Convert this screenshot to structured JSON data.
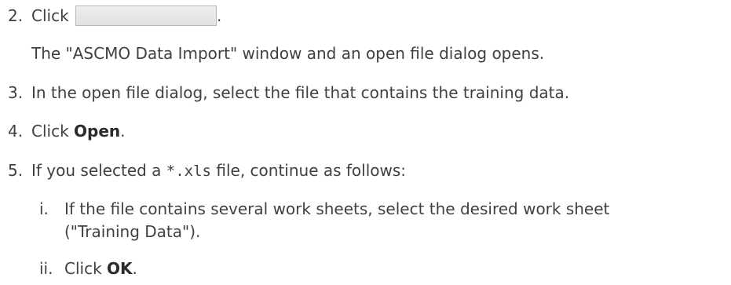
{
  "steps": [
    {
      "num": "2.",
      "before": "Click",
      "after": "."
    },
    {
      "result": "The \"ASCMO Data Import\" window and an open file dialog opens."
    },
    {
      "num": "3.",
      "text": "In the open file dialog, select the file that contains the training data."
    },
    {
      "num": "4.",
      "before": "Click ",
      "bold": "Open",
      "after": "."
    },
    {
      "num": "5.",
      "before": "If you selected a ",
      "code": "*.xls",
      "after": " file, continue as follows:"
    }
  ],
  "substeps": [
    {
      "num": "i.",
      "line1": "If the file contains several work sheets, select the desired work sheet",
      "line2": "(\"Training Data\")."
    },
    {
      "num": "ii.",
      "before": "Click ",
      "bold": "OK",
      "after": "."
    }
  ]
}
